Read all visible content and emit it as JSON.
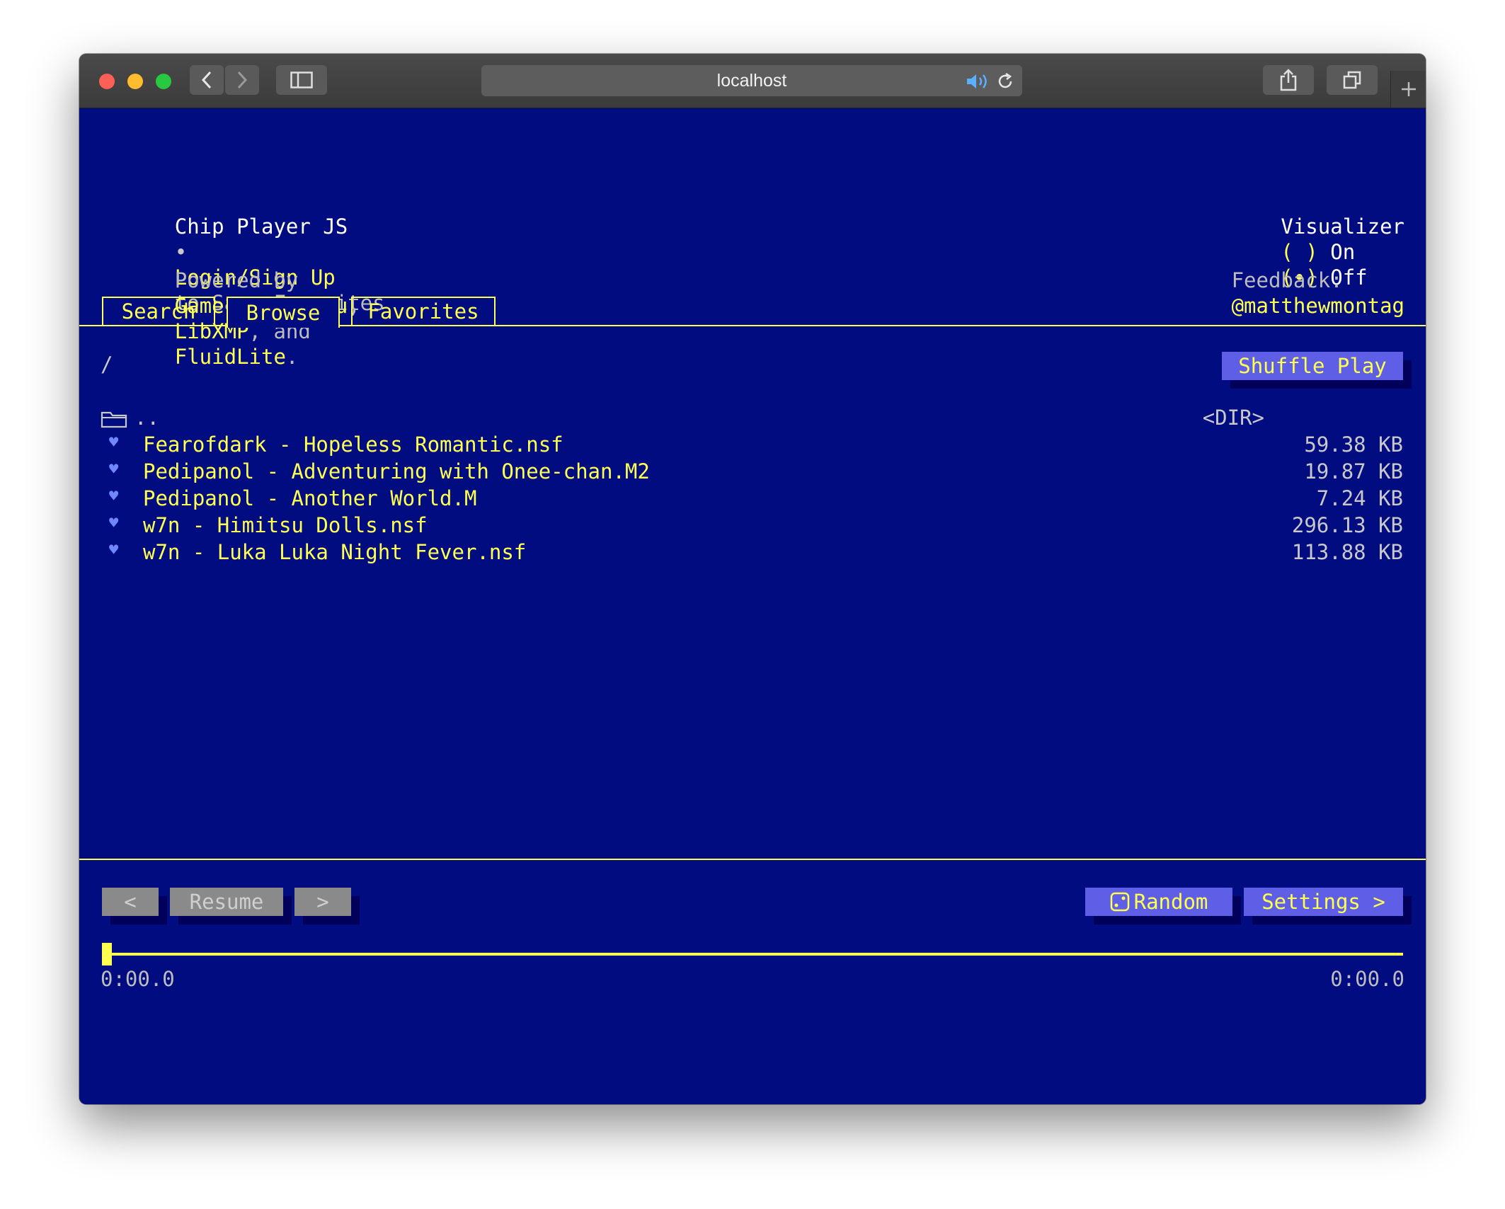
{
  "browser": {
    "url": "localhost"
  },
  "header": {
    "app_name": "Chip Player JS",
    "separator": "•",
    "login_link": "Login/Sign Up",
    "login_suffix": "to Save Favorites",
    "powered_prefix": "Powered by",
    "powered_gme": "Game Music Emu",
    "powered_comma": ",",
    "powered_libxmp": "LibXMP",
    "powered_and": ", and",
    "powered_fluid": "FluidLite",
    "powered_period": ".",
    "visualizer_label": "Visualizer",
    "visualizer_on_radio": "( )",
    "visualizer_on": "On",
    "visualizer_off_radio": "(•)",
    "visualizer_off": "Off",
    "feedback_label": "Feedback:",
    "feedback_handle": "@matthewmontag"
  },
  "tabs": [
    {
      "label": "Search"
    },
    {
      "label": "Browse"
    },
    {
      "label": "Favorites"
    }
  ],
  "browser_pane": {
    "path": "/",
    "shuffle_label": "Shuffle Play",
    "parent_dir": "..",
    "parent_size": "<DIR>",
    "files": [
      {
        "name": "Fearofdark - Hopeless Romantic.nsf",
        "size": "59.38 KB"
      },
      {
        "name": "Pedipanol - Adventuring with Onee-chan.M2",
        "size": "19.87 KB"
      },
      {
        "name": "Pedipanol - Another World.M",
        "size": "7.24 KB"
      },
      {
        "name": "w7n - Himitsu Dolls.nsf",
        "size": "296.13 KB"
      },
      {
        "name": "w7n - Luka Luka Night Fever.nsf",
        "size": "113.88 KB"
      }
    ]
  },
  "player": {
    "prev_label": "<",
    "resume_label": "Resume",
    "next_label": ">",
    "random_label": "Random",
    "settings_label": "Settings >",
    "time_elapsed": "0:00.0",
    "time_total": "0:00.0",
    "progress": 0
  },
  "colors": {
    "background": "#000c80",
    "accent": "#ffff52",
    "button": "#5e5ee6"
  }
}
